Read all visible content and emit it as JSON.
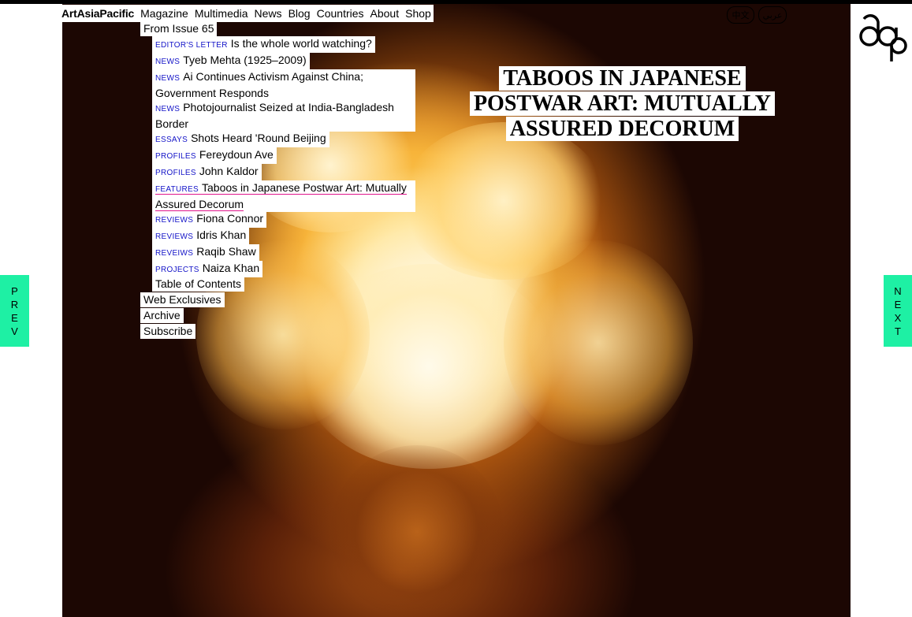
{
  "nav": {
    "brand": "ArtAsiaPacific",
    "links": [
      "Magazine",
      "Multimedia",
      "News",
      "Blog",
      "Countries",
      "About",
      "Shop"
    ]
  },
  "menu": {
    "issue": "From Issue 65",
    "items": [
      {
        "category": "Editor's Letter",
        "title": "Is the whole world watching?"
      },
      {
        "category": "News",
        "title": "Tyeb Mehta (1925–2009)"
      },
      {
        "category": "News",
        "title": "Ai Continues Activism Against China;",
        "title2": "Government Responds"
      },
      {
        "category": "News",
        "title": "Photojournalist Seized at India-Bangladesh",
        "title2": "Border"
      },
      {
        "category": "Essays",
        "title": "Shots Heard 'Round Beijing"
      },
      {
        "category": "Profiles",
        "title": "Fereydoun Ave"
      },
      {
        "category": "Profiles",
        "title": "John Kaldor"
      },
      {
        "category": "Features",
        "title": "Taboos in Japanese Postwar Art: Mutually",
        "title2": "Assured Decorum"
      },
      {
        "category": "Reviews",
        "title": "Fiona Connor"
      },
      {
        "category": "Reviews",
        "title": "Idris Khan"
      },
      {
        "category": "Reveiws",
        "title": "Raqib Shaw"
      },
      {
        "category": "Projects",
        "title": "Naiza Khan"
      }
    ],
    "toc": "Table of Contents",
    "web_exclusives": "Web Exclusives",
    "archive": "Archive",
    "subscribe": "Subscribe"
  },
  "languages": {
    "chinese": "中文",
    "arabic": "عربي"
  },
  "article_title": "TABOOS IN JAPANESE POSTWAR ART: MUTUALLY ASSURED DECORUM",
  "prev": [
    "P",
    "R",
    "E",
    "V"
  ],
  "next": [
    "N",
    "E",
    "X",
    "T"
  ],
  "colors": {
    "accent_green": "#1ef0a4",
    "category_blue": "#1414c8",
    "active_underline": "#e0168c"
  },
  "icons": {
    "logo": "aap-logo-icon"
  }
}
